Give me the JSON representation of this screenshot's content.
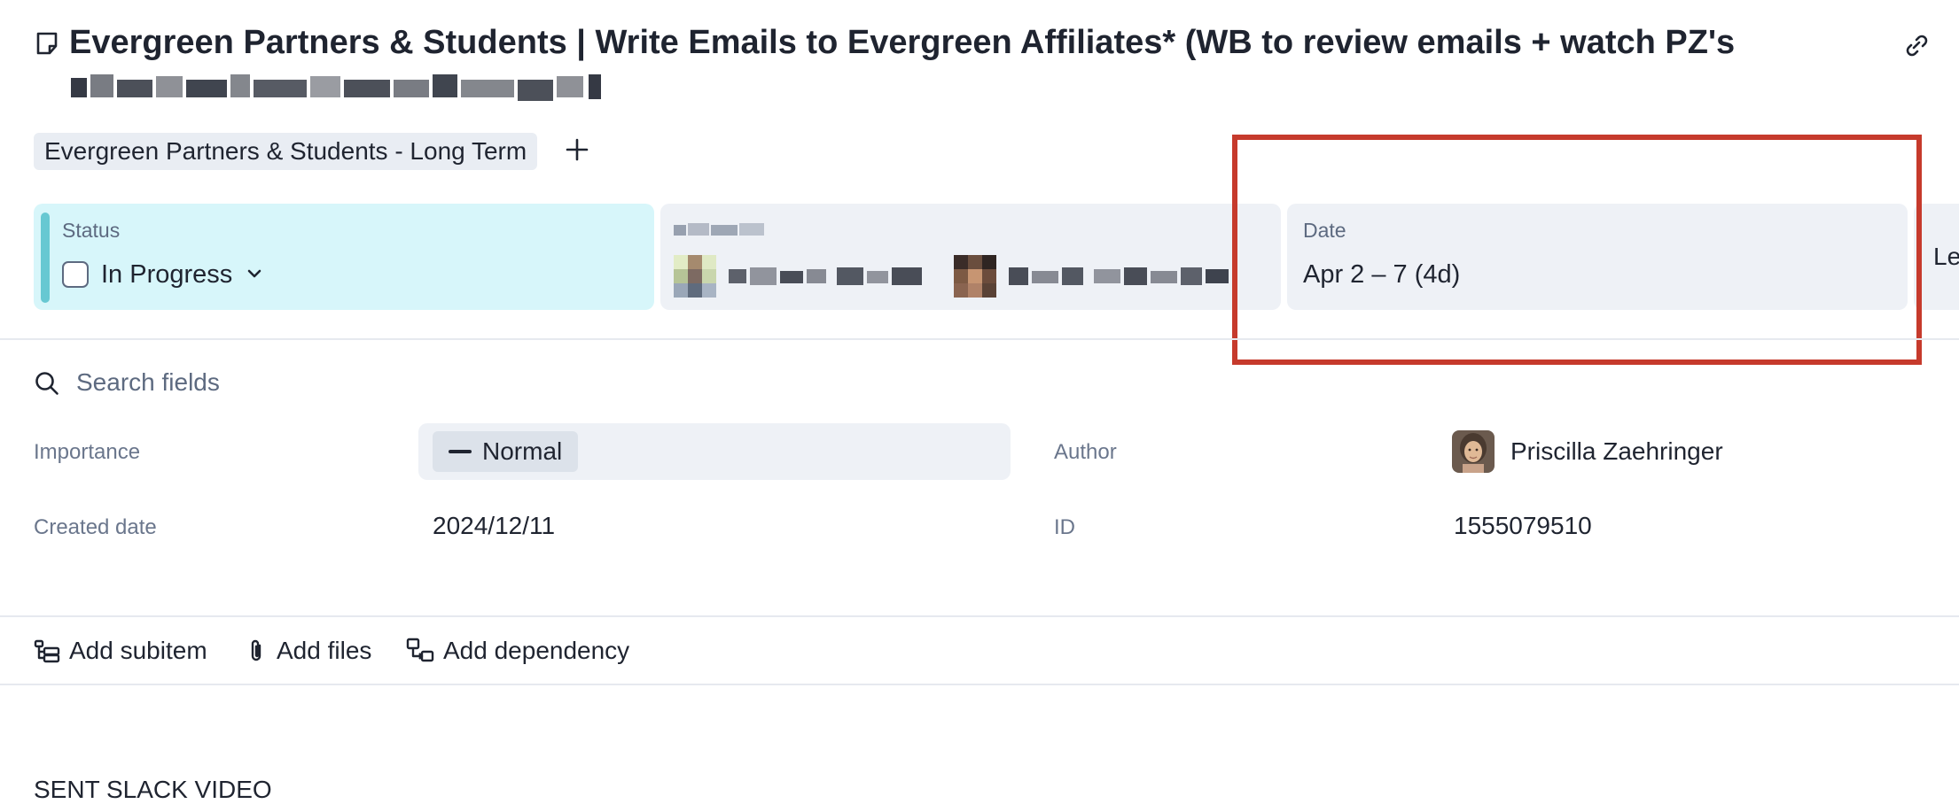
{
  "item": {
    "title": "Evergreen Partners & Students | Write Emails to Evergreen Affiliates* (WB to review emails + watch PZ's",
    "group_tag": "Evergreen Partners & Students - Long Term"
  },
  "cards": {
    "status": {
      "label": "Status",
      "value": "In Progress"
    },
    "date": {
      "label": "Date",
      "value": "Apr 2 – 7 (4d)"
    },
    "partial_label": "Le"
  },
  "search": {
    "placeholder": "Search fields"
  },
  "fields": {
    "importance": {
      "label": "Importance",
      "value": "Normal"
    },
    "author": {
      "label": "Author",
      "value": "Priscilla Zaehringer"
    },
    "created_date": {
      "label": "Created date",
      "value": "2024/12/11"
    },
    "id": {
      "label": "ID",
      "value": "1555079510"
    }
  },
  "actions": {
    "add_subitem": "Add subitem",
    "add_files": "Add files",
    "add_dependency": "Add dependency"
  },
  "body_text": "SENT SLACK VIDEO",
  "colors": {
    "status_card": "#d7f6fa",
    "status_accent": "#67c8d2",
    "highlight_frame": "#c63a2c"
  },
  "icons": [
    "note-icon",
    "link-icon",
    "plus-icon",
    "chevron-down-icon",
    "search-icon",
    "minus-icon",
    "subitem-icon",
    "paperclip-icon",
    "dependency-icon"
  ]
}
